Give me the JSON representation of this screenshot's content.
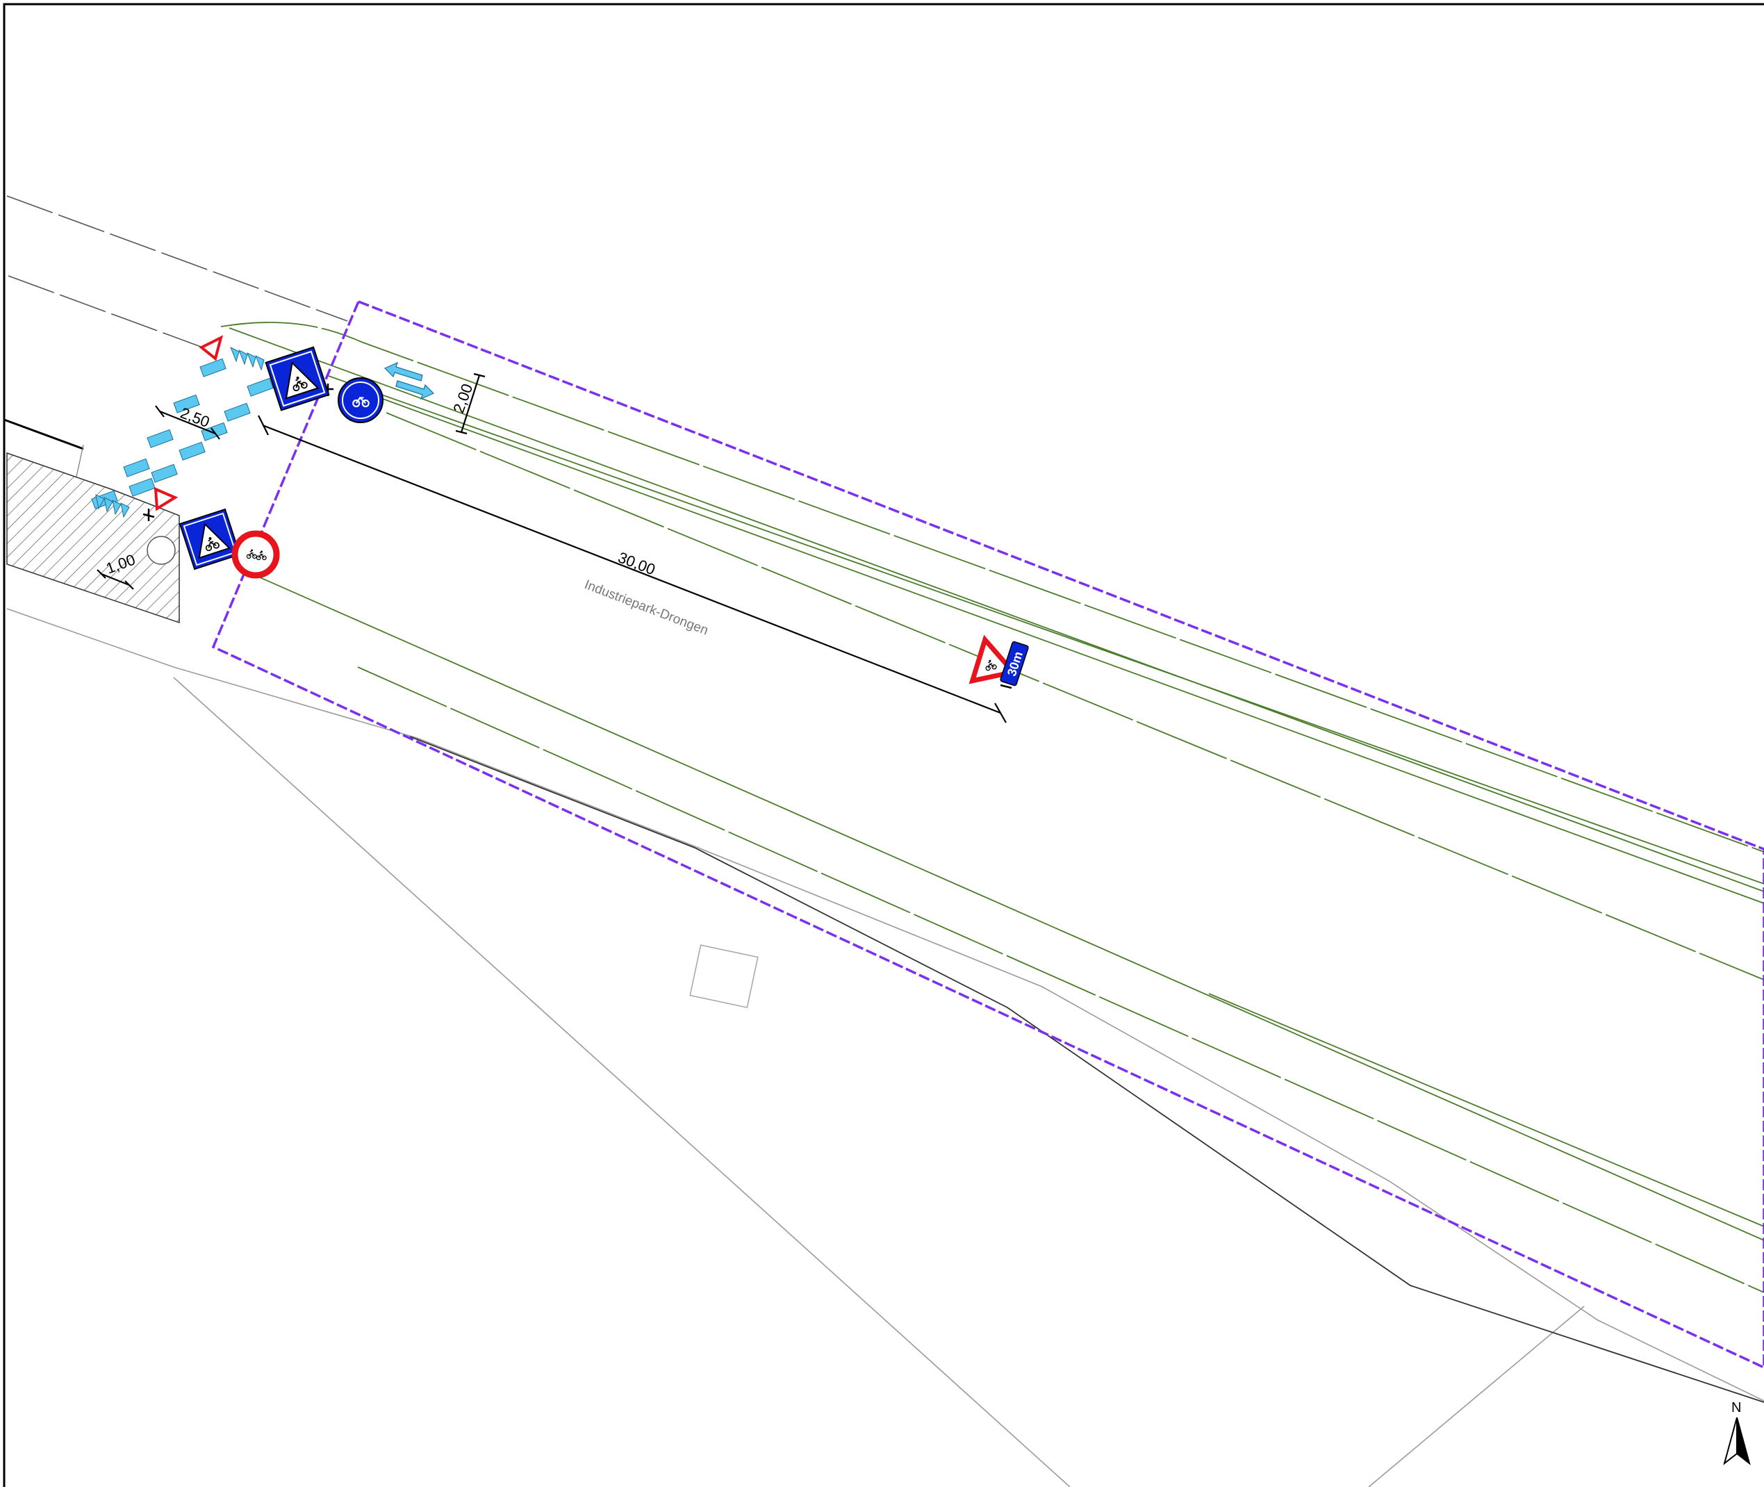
{
  "drawing": {
    "dimensions": {
      "crossing_width": "2,50",
      "lane_width": "2,00",
      "zone_length": "30,00",
      "island_width": "1,00"
    },
    "street_name": "Industriepark-Drongen",
    "warning_plate_text": "30m",
    "north_label": "N"
  },
  "icons": [
    "cycle-crossing-sign-icon",
    "shared-path-sign-icon",
    "no-mopeds-sign-icon",
    "yield-triangle-icon",
    "shark-teeth-icon",
    "two-way-arrows-icon",
    "cyclist-warning-sign-icon",
    "north-arrow-icon"
  ],
  "colors": {
    "boundary": "#7b2ff0",
    "road_line": "#4a7c2a",
    "crossing_fill": "#5bc8f0",
    "sign_blue": "#0a24d8",
    "sign_red": "#e8141c"
  }
}
